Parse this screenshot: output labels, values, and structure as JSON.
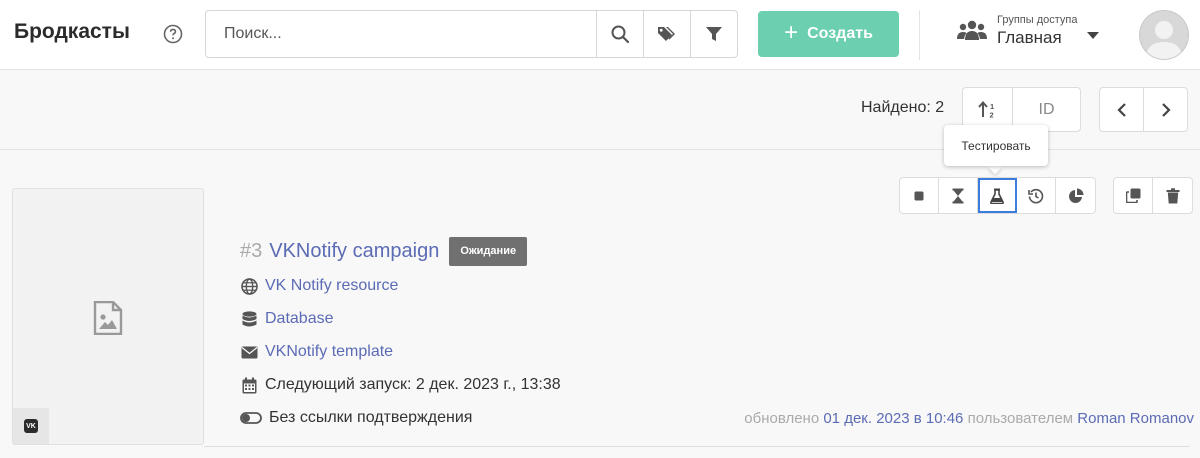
{
  "header": {
    "title": "Бродкасты",
    "search_placeholder": "Поиск...",
    "create_label": "Создать",
    "access": {
      "label": "Группы доступа",
      "value": "Главная"
    }
  },
  "toolbar": {
    "found_label": "Найдено: 2",
    "sort_field": "ID"
  },
  "tooltip": {
    "text": "Тестировать"
  },
  "broadcast": {
    "id": "#3",
    "title": "VKNotify campaign",
    "status": "Ожидание",
    "resource": "VK Notify resource",
    "database": "Database",
    "template": "VKNotify template",
    "next_run": "Следующий запуск: 2 дек. 2023 г., 13:38",
    "confirmation": "Без ссылки подтверждения",
    "channel_badge": "VK",
    "updated_prefix": "обновлено",
    "updated_date": "01 дек. 2023 в 10:46",
    "updated_by_prefix": "пользователем",
    "updated_by": "Roman Romanov"
  },
  "icons": {
    "help": "question-circle-icon",
    "search": "search-icon",
    "tags": "tags-icon",
    "filter": "filter-icon",
    "plus": "plus-icon",
    "users": "users-icon",
    "caret": "caret-down-icon",
    "sort": "sort-amount-icon",
    "prev": "chevron-left-icon",
    "next": "chevron-right-icon",
    "stop": "stop-icon",
    "hourglass": "hourglass-icon",
    "flask": "flask-icon",
    "history": "history-icon",
    "stats": "pie-chart-icon",
    "copy": "copy-icon",
    "delete": "trash-icon",
    "globe": "globe-icon",
    "database": "database-icon",
    "envelope": "envelope-icon",
    "calendar": "calendar-icon",
    "toggle": "toggle-off-icon",
    "image": "image-file-icon"
  },
  "colors": {
    "accent": "#6ccfb0",
    "link": "#5b6bb5",
    "status_badge": "#707070",
    "focus": "#3b7ddd"
  }
}
